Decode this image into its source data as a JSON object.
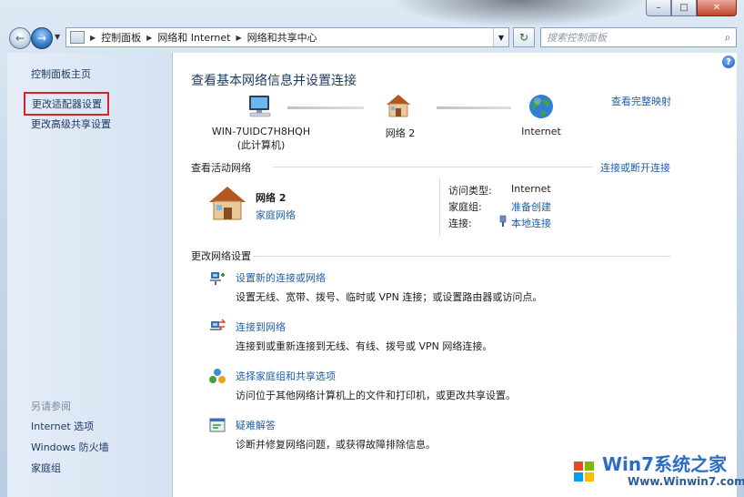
{
  "nav": {
    "breadcrumb": [
      "控制面板",
      "网络和 Internet",
      "网络和共享中心"
    ],
    "search_placeholder": "搜索控制面板"
  },
  "sidebar": {
    "home": "控制面板主页",
    "items": [
      "更改适配器设置",
      "更改高级共享设置"
    ],
    "see_also_title": "另请参阅",
    "see_also": [
      "Internet 选项",
      "Windows 防火墙",
      "家庭组"
    ]
  },
  "main": {
    "title": "查看基本网络信息并设置连接",
    "full_map_link": "查看完整映射",
    "network_map": {
      "computer_name": "WIN-7UIDC7H8HQH",
      "computer_note": "(此计算机)",
      "network_name": "网络  2",
      "internet_label": "Internet"
    },
    "active_networks": {
      "heading": "查看活动网络",
      "connect_link": "连接或断开连接",
      "network_name": "网络  2",
      "network_type": "家庭网络",
      "access_type_label": "访问类型:",
      "access_type_value": "Internet",
      "homegroup_label": "家庭组:",
      "homegroup_value": "准备创建",
      "connections_label": "连接:",
      "connections_value": "本地连接"
    },
    "change_settings": {
      "heading": "更改网络设置",
      "tasks": [
        {
          "title": "设置新的连接或网络",
          "desc": "设置无线、宽带、拨号、临时或 VPN 连接；或设置路由器或访问点。"
        },
        {
          "title": "连接到网络",
          "desc": "连接到或重新连接到无线、有线、拨号或 VPN 网络连接。"
        },
        {
          "title": "选择家庭组和共享选项",
          "desc": "访问位于其他网络计算机上的文件和打印机，或更改共享设置。"
        },
        {
          "title": "疑难解答",
          "desc": "诊断并修复网络问题，或获得故障排除信息。"
        }
      ]
    }
  },
  "watermark": {
    "brand": "Win7系统之家",
    "url": "Www.Winwin7.com"
  },
  "colors": {
    "link": "#1f5fa8",
    "highlight_border": "#d2242b",
    "sidebar_bg": "#dbe6f4"
  }
}
